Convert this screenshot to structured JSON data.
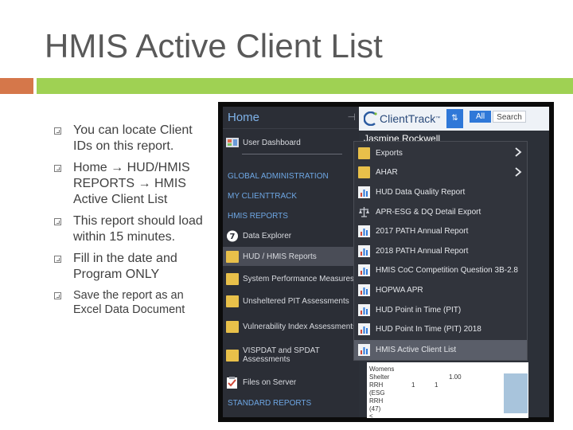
{
  "slide": {
    "title": "HMIS Active Client List",
    "bullets": [
      "You can locate Client IDs on this report.",
      "Home → HUD/HMIS REPORTS → HMIS Active Client List",
      "This report should load within 15 minutes.",
      "Fill in the date and Program ONLY",
      "Save the report as an Excel Data Document"
    ],
    "colors": {
      "accent_orange": "#d5774a",
      "accent_green": "#9fd153",
      "title": "#595959"
    }
  },
  "app": {
    "brand": "ClientTrack",
    "trademark": "™",
    "sort_icon_label": "⇅",
    "all_label": "All",
    "search_label": "Search",
    "partial_heading": "Jasmine Rockwell",
    "colors": {
      "blue": "#2f78d8",
      "sidebar_bg": "#2b2e36",
      "link_blue": "#6ea7e4"
    }
  },
  "sidebar": {
    "home_label": "Home",
    "pin_icon": "pin-icon",
    "items": {
      "user_dashboard": "User Dashboard",
      "global_admin": "GLOBAL ADMINISTRATION",
      "my_clienttrack": "MY CLIENTTRACK",
      "hmis_reports": "HMIS REPORTS",
      "data_explorer": "Data Explorer",
      "hud_hmis_reports": "HUD / HMIS Reports",
      "system_performance": "System Performance Measures",
      "unsheltered_pit": "Unsheltered PIT Assessments",
      "vulnerability_index": "Vulnerability Index Assessments",
      "vispdat": "VISPDAT and SPDAT Assessments",
      "files_on_server": "Files on Server",
      "standard_reports": "STANDARD REPORTS"
    }
  },
  "dropdown": {
    "items": [
      "Exports",
      "AHAR",
      "HUD Data Quality Report",
      "APR-ESG & DQ Detail Export",
      "2017 PATH Annual Report",
      "2018 PATH Annual Report",
      "HMIS CoC Competition Question 3B-2.8",
      "HOPWA APR",
      "HUD Point in Time (PIT)",
      "HUD Point In Time (PIT) 2018",
      "HMIS Active Client List"
    ],
    "selected": "HMIS Active Client List"
  },
  "partial_table": {
    "lines": [
      "Womens",
      "Shelter",
      "RRH",
      "(ESG",
      "RRH",
      "(47)",
      "<"
    ],
    "val_a": "1.00",
    "val_b": "1",
    "val_c": "1"
  }
}
